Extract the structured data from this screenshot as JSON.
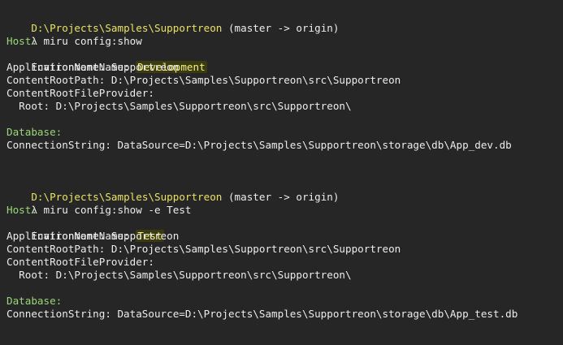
{
  "session1": {
    "prompt_path": "D:\\Projects\\Samples\\Supportreon",
    "prompt_branch": " (master -> origin)",
    "command_symbol": "λ",
    "command": " miru config:show",
    "host_label": "Host:",
    "env_key": "EnvironmentName: ",
    "env_value": "Development",
    "app_name": "ApplicationName: Supportreon",
    "content_root_path": "ContentRootPath: D:\\Projects\\Samples\\Supportreon\\src\\Supportreon",
    "content_root_provider": "ContentRootFileProvider:",
    "root": "  Root: D:\\Projects\\Samples\\Supportreon\\src\\Supportreon\\",
    "database_label": "Database:",
    "connection_string": "ConnectionString: DataSource=D:\\Projects\\Samples\\Supportreon\\storage\\db\\App_dev.db"
  },
  "session2": {
    "prompt_path": "D:\\Projects\\Samples\\Supportreon",
    "prompt_branch": " (master -> origin)",
    "command_symbol": "λ",
    "command": " miru config:show -e Test",
    "host_label": "Host:",
    "env_key": "EnvironmentName: ",
    "env_value": "Test",
    "app_name": "ApplicationName: Supportreon",
    "content_root_path": "ContentRootPath: D:\\Projects\\Samples\\Supportreon\\src\\Supportreon",
    "content_root_provider": "ContentRootFileProvider:",
    "root": "  Root: D:\\Projects\\Samples\\Supportreon\\src\\Supportreon\\",
    "database_label": "Database:",
    "connection_string": "ConnectionString: DataSource=D:\\Projects\\Samples\\Supportreon\\storage\\db\\App_test.db"
  },
  "colors": {
    "background": "#262626",
    "text": "#ececec",
    "path": "#e8e26a",
    "label": "#9bd67a",
    "highlight": "#f4f083"
  }
}
